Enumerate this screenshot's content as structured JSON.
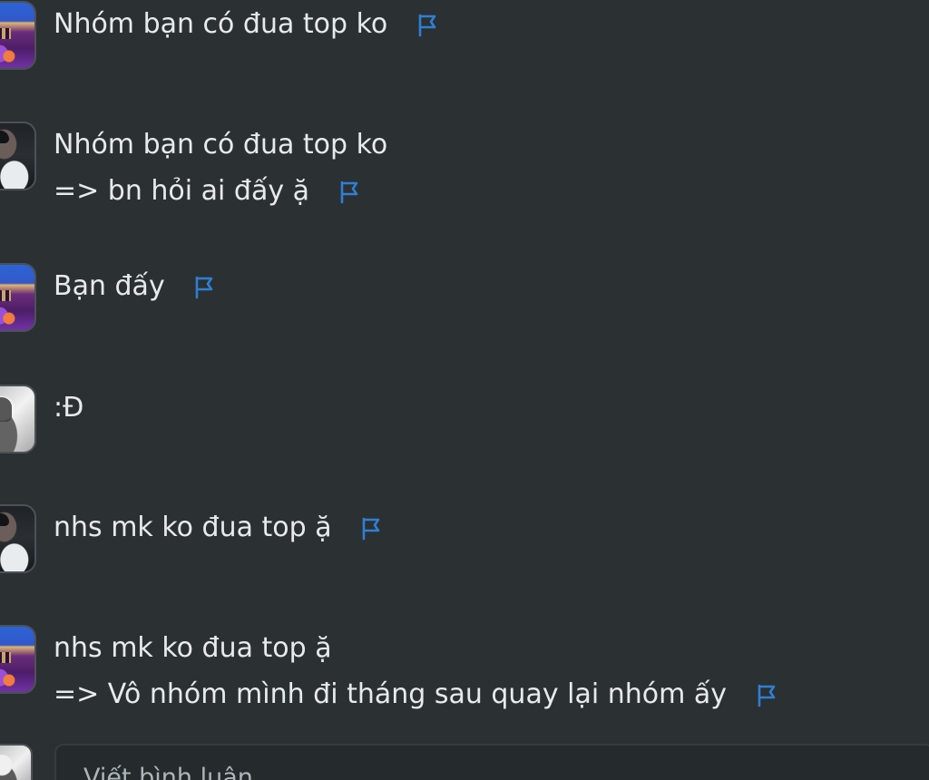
{
  "comments": [
    {
      "avatar": "castle-avatar",
      "lines": [
        "Nhóm bạn có đua top ko"
      ]
    },
    {
      "avatar": "person-avatar",
      "lines": [
        "Nhóm bạn có đua top ko",
        "=> bn hỏi ai đấy ặ"
      ]
    },
    {
      "avatar": "castle-avatar",
      "lines": [
        "Bạn đấy"
      ]
    },
    {
      "avatar": "gray-avatar",
      "lines": [
        ":Đ"
      ]
    },
    {
      "avatar": "person-avatar",
      "lines": [
        "nhs mk ko đua top ặ"
      ]
    },
    {
      "avatar": "castle-avatar",
      "lines": [
        "nhs mk ko đua top ặ",
        "=> Vô nhóm mình đi tháng sau quay lại nhóm ấy"
      ]
    }
  ],
  "composer": {
    "placeholder": "Viết bình luận..."
  },
  "icons": {
    "flag": "flag-icon",
    "flag_color": "#2f7fd3"
  }
}
